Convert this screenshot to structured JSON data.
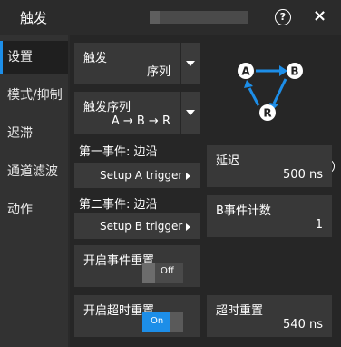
{
  "title": "触发",
  "header": {
    "help_label": "?",
    "close_label": "×"
  },
  "sidebar": {
    "items": [
      {
        "label": "设置",
        "active": true
      },
      {
        "label": "模式/抑制",
        "active": false
      },
      {
        "label": "迟滞",
        "active": false
      },
      {
        "label": "通道滤波",
        "active": false
      },
      {
        "label": "动作",
        "active": false
      }
    ]
  },
  "trigger_select": {
    "label": "触发",
    "value": "序列"
  },
  "sequence_select": {
    "label": "触发序列",
    "value": "A → B → R"
  },
  "diagram": {
    "node_a": "A",
    "node_b": "B",
    "node_r": "R",
    "help_label": "?",
    "arrow_color": "#1d8ee8"
  },
  "event1": {
    "label": "第一事件: 边沿",
    "button": "Setup A trigger"
  },
  "event2": {
    "label": "第二事件: 边沿",
    "button": "Setup B trigger"
  },
  "delay": {
    "label": "延迟",
    "value": "500 ns"
  },
  "b_count": {
    "label": "B事件计数",
    "value": "1"
  },
  "event_reset": {
    "label": "开启事件重置",
    "state": "Off"
  },
  "timeout_reset_enable": {
    "label": "开启超时重置",
    "state": "On"
  },
  "timeout_reset": {
    "label": "超时重置",
    "value": "540 ns"
  },
  "colors": {
    "accent": "#1d8ee8",
    "background": "#262626",
    "field": "#383838"
  }
}
